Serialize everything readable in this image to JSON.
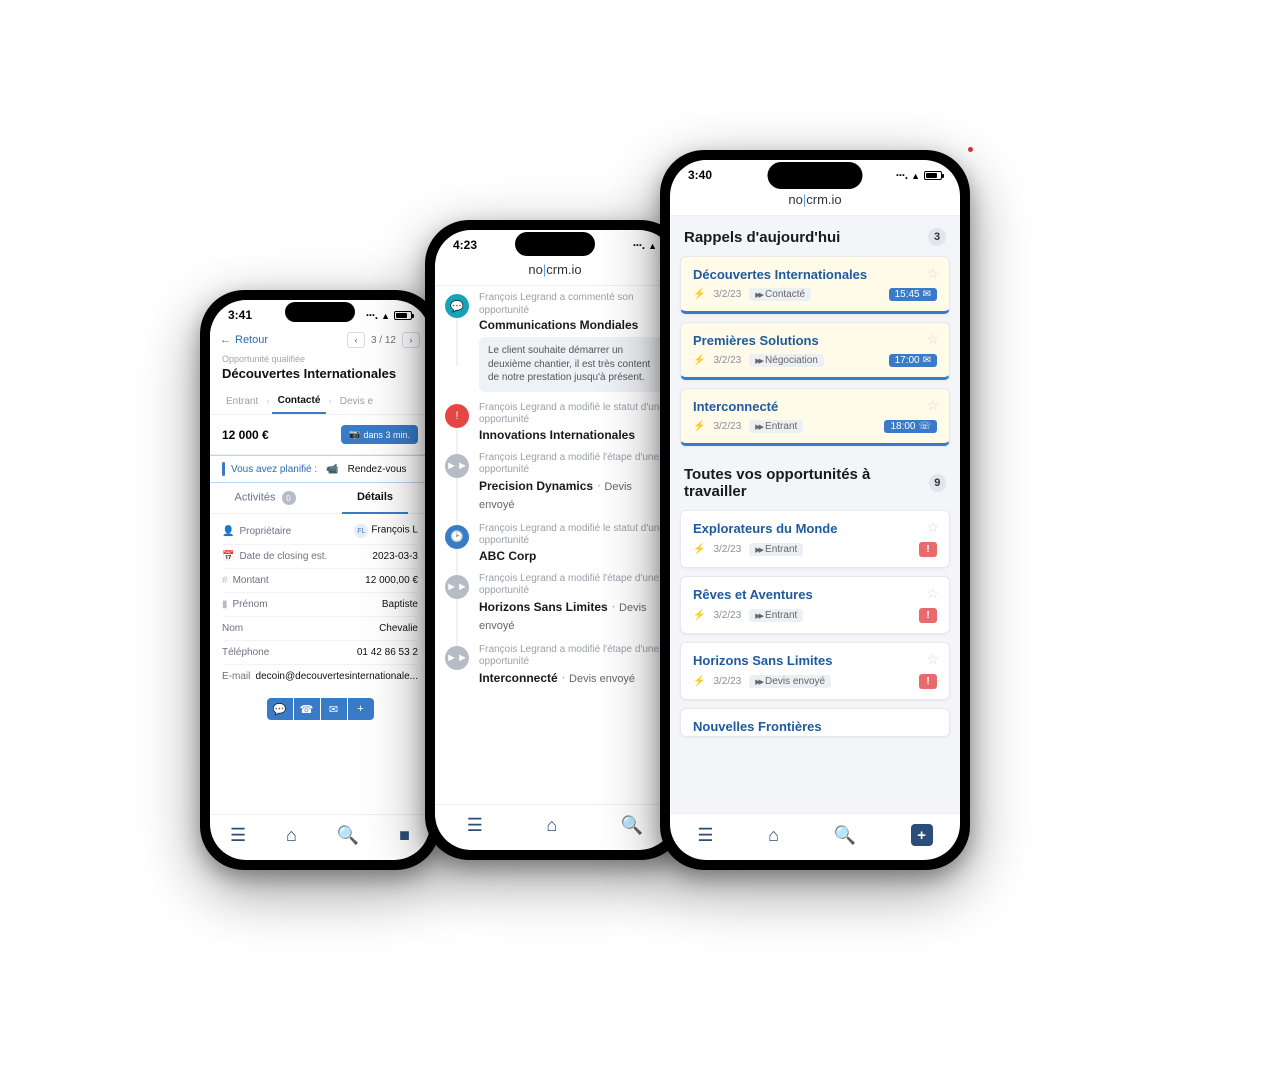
{
  "brand": {
    "left": "no",
    "right": "crm.io"
  },
  "phoneA": {
    "time": "3:41",
    "back": "Retour",
    "pager": "3 / 12",
    "sub_label": "Opportunité qualifiée",
    "title": "Découvertes Internationales",
    "tabs": {
      "t1": "Entrant",
      "t2": "Contacté",
      "t3": "Devis e"
    },
    "amount": "12 000 €",
    "sched_btn": "dans 3 min.",
    "planned_label": "Vous avez planifié :",
    "planned_value": "Rendez-vous",
    "subtabs": {
      "activities": "Activités",
      "activities_count": "0",
      "details": "Détails"
    },
    "rows": {
      "owner_lbl": "Propriétaire",
      "owner_val": "François L",
      "owner_initials": "FL",
      "closing_lbl": "Date de closing est.",
      "closing_val": "2023-03-3",
      "amount_lbl": "Montant",
      "amount_val": "12 000,00 €",
      "firstname_lbl": "Prénom",
      "firstname_val": "Baptiste",
      "name_lbl": "Nom",
      "name_val": "Chevalie",
      "phone_lbl": "Téléphone",
      "phone_val": "01 42 86 53 2",
      "email_lbl": "E-mail",
      "email_val": "decoin@decouvertesinternationale..."
    }
  },
  "phoneB": {
    "time": "4:23",
    "timeline": [
      {
        "meta": "François Legrand a commenté son opportunité",
        "title": "Communications Mondiales",
        "quote": "Le client souhaite démarrer un deuxième chantier, il est très content de notre prestation jusqu'à présent."
      },
      {
        "meta": "François Legrand a modifié le statut d'une opportunité",
        "title": "Innovations Internationales"
      },
      {
        "meta": "François Legrand a modifié l'étape d'une opportunité",
        "title": "Precision Dynamics",
        "stage": "Devis envoyé"
      },
      {
        "meta": "François Legrand a modifié le statut d'une opportunité",
        "title": "ABC Corp"
      },
      {
        "meta": "François Legrand a modifié l'étape d'une opportunité",
        "title": "Horizons Sans Limites",
        "stage": "Devis envoyé"
      },
      {
        "meta": "François Legrand a modifié l'étape d'une opportunité",
        "title": "Interconnecté",
        "stage": "Devis envoyé"
      }
    ]
  },
  "phoneC": {
    "time": "3:40",
    "section1_title": "Rappels d'aujourd'hui",
    "section1_count": "3",
    "reminders": [
      {
        "title": "Découvertes Internationales",
        "date": "3/2/23",
        "stage": "Contacté",
        "time": "15:45"
      },
      {
        "title": "Premières Solutions",
        "date": "3/2/23",
        "stage": "Négociation",
        "time": "17:00"
      },
      {
        "title": "Interconnecté",
        "date": "3/2/23",
        "stage": "Entrant",
        "time": "18:00",
        "phone_pill": true
      }
    ],
    "section2_title": "Toutes vos opportunités à travailler",
    "section2_count": "9",
    "leads": [
      {
        "title": "Explorateurs du Monde",
        "date": "3/2/23",
        "stage": "Entrant"
      },
      {
        "title": "Rêves et Aventures",
        "date": "3/2/23",
        "stage": "Entrant"
      },
      {
        "title": "Horizons Sans Limites",
        "date": "3/2/23",
        "stage": "Devis envoyé"
      },
      {
        "title_cut": "Nouvelles Frontières"
      }
    ]
  }
}
